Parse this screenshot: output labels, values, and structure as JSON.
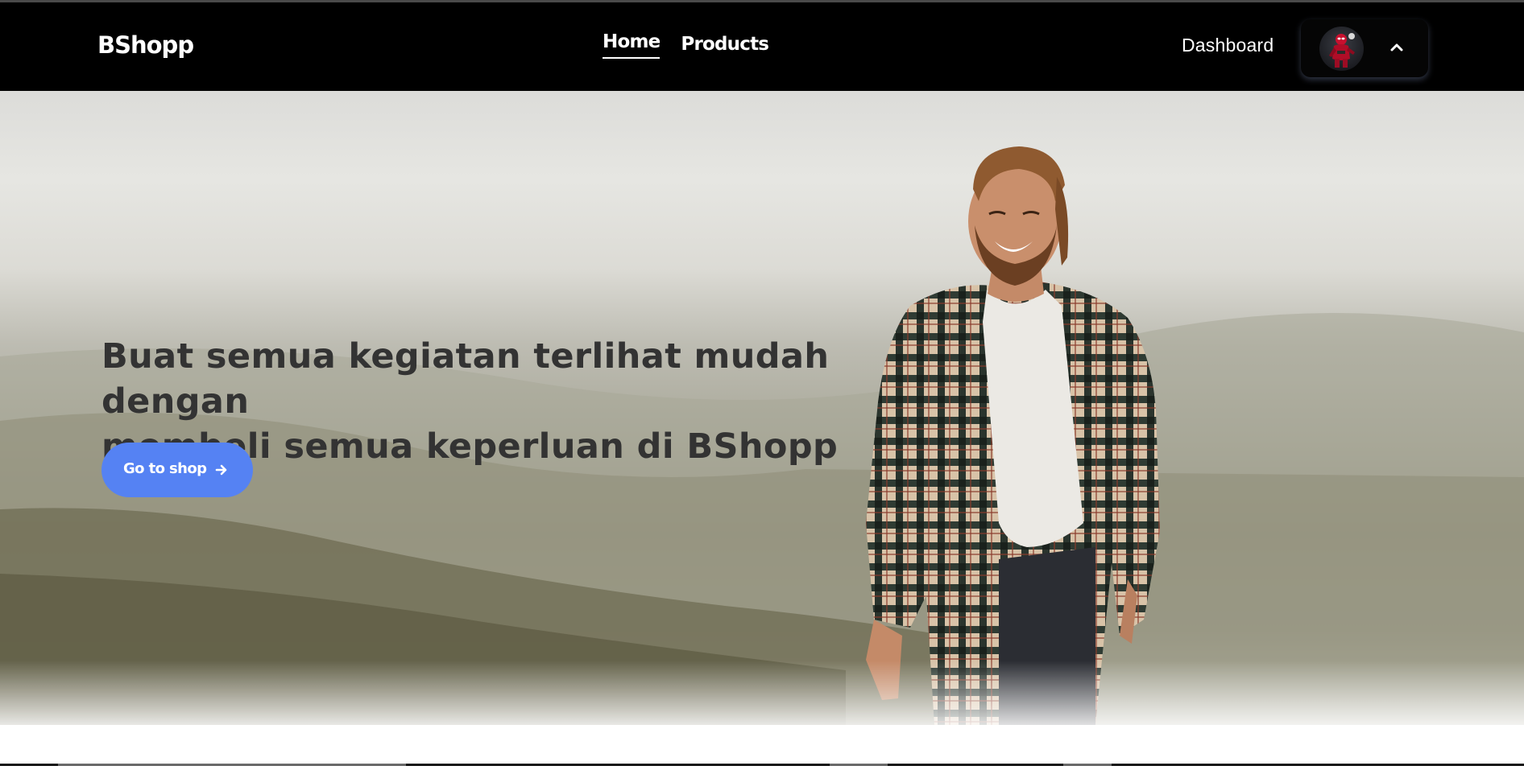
{
  "nav": {
    "brand": "BShopp",
    "links": [
      {
        "label": "Home",
        "active": true
      },
      {
        "label": "Products",
        "active": false
      }
    ],
    "dashboard_label": "Dashboard",
    "user_menu": {
      "avatar_icon": "superhero-avatar",
      "toggle_icon": "chevron-up-icon"
    }
  },
  "hero": {
    "headline_line1": "Buat semua kegiatan terlihat mudah dengan",
    "headline_line2": "membeli semua keperluan di BShopp",
    "cta_label": "Go to shop",
    "cta_icon": "arrow-right-icon",
    "image": "smiling-man-in-plaid-shirt-mountain-landscape"
  },
  "colors": {
    "navbar_bg": "#000000",
    "cta_bg": "#5582f3",
    "headline": "#333333"
  }
}
